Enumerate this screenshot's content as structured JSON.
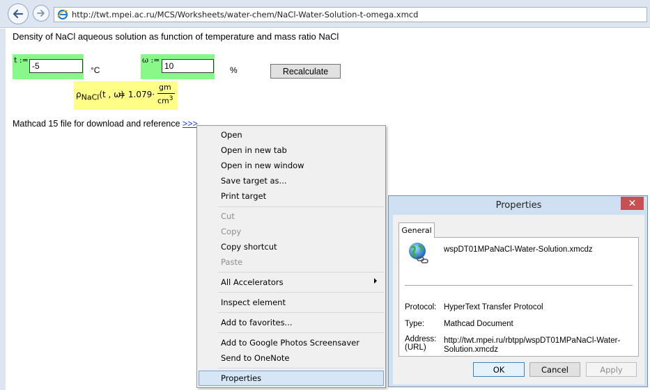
{
  "browser": {
    "url": "http://twt.mpei.ac.ru/MCS/Worksheets/water-chem/NaCl-Water-Solution-t-omega.xmcd"
  },
  "page": {
    "title": "Density of NaCl aqueous solution as function of temperature and mass ratio NaCl",
    "t_label": "t :=",
    "t_value": "-5",
    "t_unit": "°C",
    "omega_label": "ω :=",
    "omega_value": "10",
    "omega_unit": "%",
    "recalculate_label": "Recalculate",
    "result": {
      "rho_symbol": "ρ",
      "rho_subscript": "NaCl",
      "rho_args": "(t , ω)",
      "equals_value": "= 1.079·",
      "unit_numerator": "gm",
      "unit_denominator": "cm",
      "unit_exponent": "3"
    },
    "download_text": "Mathcad 15 file for download and reference",
    "download_link": ">>>"
  },
  "context_menu": {
    "items": [
      {
        "label": "Open",
        "disabled": false
      },
      {
        "label": "Open in new tab",
        "disabled": false
      },
      {
        "label": "Open in new window",
        "disabled": false
      },
      {
        "label": "Save target as...",
        "disabled": false
      },
      {
        "label": "Print target",
        "disabled": false
      },
      {
        "label": "Cut",
        "disabled": true
      },
      {
        "label": "Copy",
        "disabled": true
      },
      {
        "label": "Copy shortcut",
        "disabled": false
      },
      {
        "label": "Paste",
        "disabled": true
      },
      {
        "label": "All Accelerators",
        "disabled": false,
        "submenu": true
      },
      {
        "label": "Inspect element",
        "disabled": false
      },
      {
        "label": "Add to favorites...",
        "disabled": false
      },
      {
        "label": "Add to Google Photos Screensaver",
        "disabled": false
      },
      {
        "label": "Send to OneNote",
        "disabled": false
      },
      {
        "label": "Properties",
        "disabled": false,
        "highlighted": true
      }
    ]
  },
  "properties_dialog": {
    "title": "Properties",
    "close_glyph": "✕",
    "tab_general": "General",
    "file_name": "wspDT01MPaNaCl-Water-Solution.xmcdz",
    "protocol_label": "Protocol:",
    "protocol_value": "HyperText Transfer Protocol",
    "type_label": "Type:",
    "type_value": "Mathcad Document",
    "address_label": "Address:\n(URL)",
    "address_value": "http://twt.mpei.ru/rbtpp/wspDT01MPaNaCl-Water-Solution.xmcdz",
    "ok_label": "OK",
    "cancel_label": "Cancel",
    "apply_label": "Apply"
  },
  "colors": {
    "input_region": "#88f988",
    "result_region": "#ffff88",
    "link": "#1a38d8",
    "close_button": "#c75050",
    "menu_highlight": "#d7e6f7"
  },
  "icons": [
    "back-arrow-icon",
    "forward-arrow-icon",
    "ie-page-icon",
    "submenu-arrow-icon",
    "globe-link-icon",
    "close-icon"
  ]
}
